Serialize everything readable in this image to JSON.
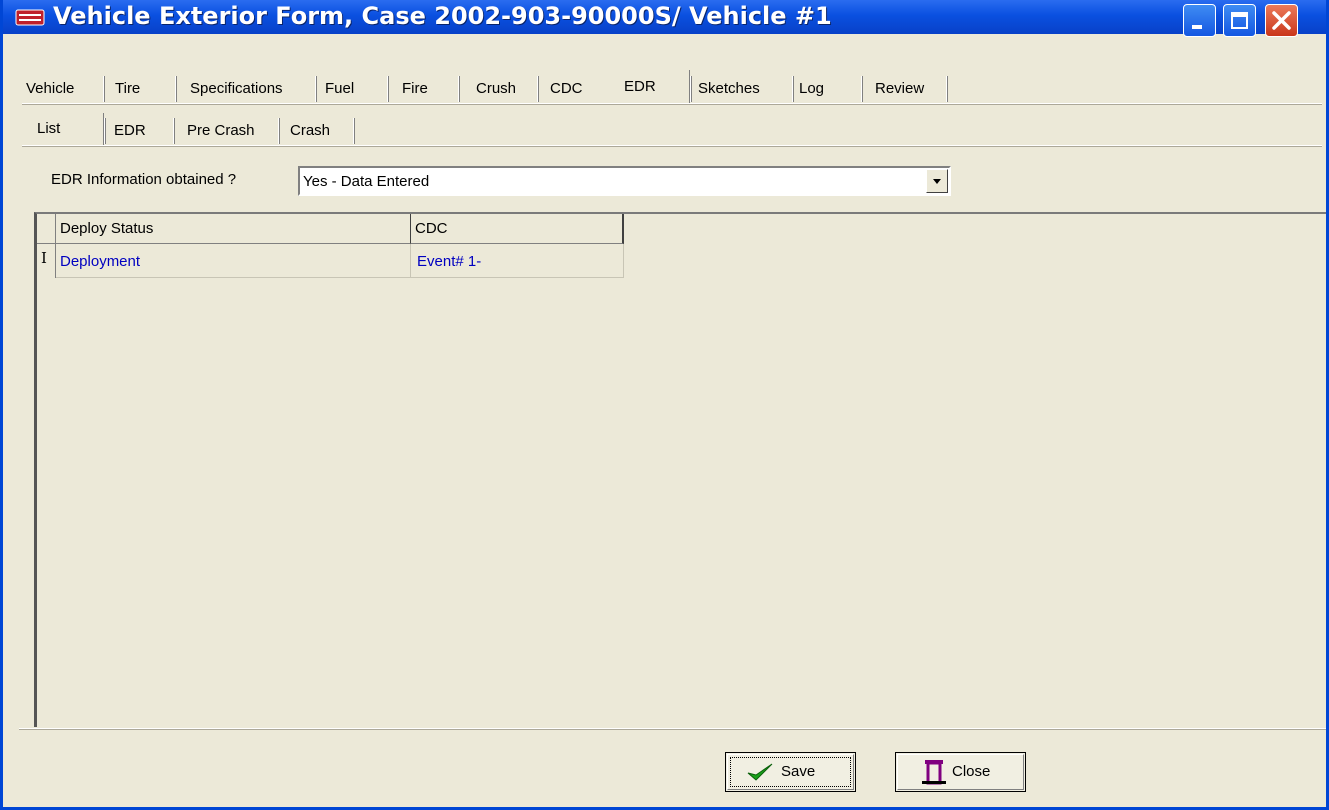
{
  "window": {
    "title": "Vehicle Exterior Form, Case 2002-903-90000S/ Vehicle #1",
    "controls": [
      "minimize",
      "maximize",
      "close"
    ]
  },
  "main_tabs": [
    {
      "label": "Vehicle",
      "active": false
    },
    {
      "label": "Tire",
      "active": false
    },
    {
      "label": "Specifications",
      "active": false
    },
    {
      "label": "Fuel",
      "active": false
    },
    {
      "label": "Fire",
      "active": false
    },
    {
      "label": "Crush",
      "active": false
    },
    {
      "label": "CDC",
      "active": false
    },
    {
      "label": "EDR",
      "active": true
    },
    {
      "label": "Sketches",
      "active": false
    },
    {
      "label": "Log",
      "active": false
    },
    {
      "label": "Review",
      "active": false
    }
  ],
  "sub_tabs": [
    {
      "label": "List",
      "active": true
    },
    {
      "label": "EDR",
      "active": false
    },
    {
      "label": "Pre Crash",
      "active": false
    },
    {
      "label": "Crash",
      "active": false
    }
  ],
  "edr_field": {
    "label": "EDR Information obtained ?",
    "value": "Yes - Data Entered"
  },
  "grid": {
    "columns": [
      "Deploy Status",
      "CDC"
    ],
    "rows": [
      {
        "deploy_status": "Deployment",
        "cdc": "Event# 1-"
      }
    ],
    "row_indicator": "I"
  },
  "buttons": {
    "save": "Save",
    "close": "Close"
  },
  "icons": {
    "title": "vehicle-icon",
    "save": "checkmark-icon",
    "close": "door-exit-icon"
  },
  "colors": {
    "title_bar": "#0a50e0",
    "window_face": "#ece9d8",
    "grid_text": "#0000c0",
    "save_check": "#1aa01a",
    "close_icon": "#800080"
  }
}
